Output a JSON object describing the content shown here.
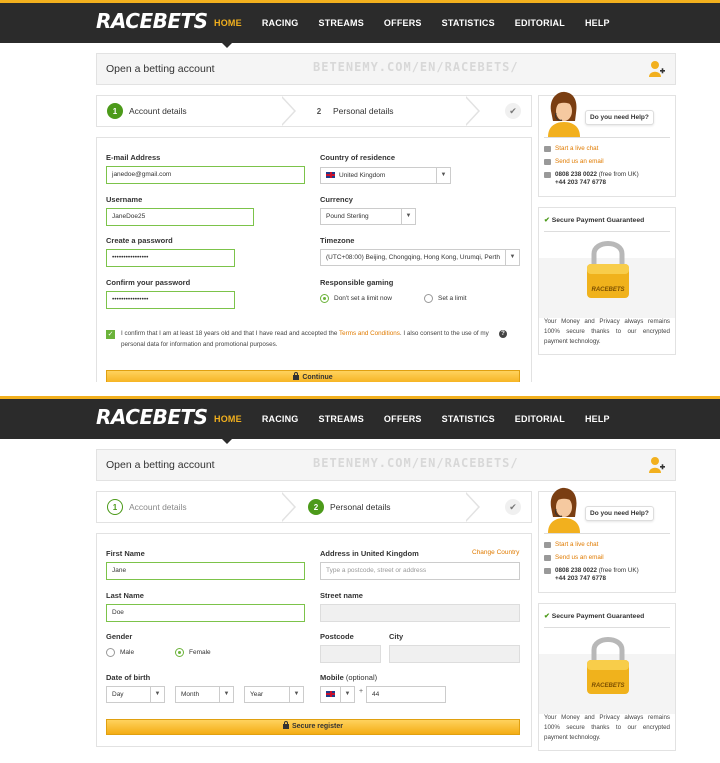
{
  "header": {
    "logo": "RACEBETS",
    "nav": [
      "HOME",
      "RACING",
      "STREAMS",
      "OFFERS",
      "STATISTICS",
      "EDITORIAL",
      "HELP"
    ],
    "active_nav": "HOME"
  },
  "page": {
    "title": "Open a betting account",
    "watermark": "BETENEMY.COM/EN/RACEBETS/"
  },
  "steps": {
    "step1_num": "1",
    "step1_label": "Account details",
    "step2_num": "2",
    "step2_label": "Personal details",
    "done_icon": "✔"
  },
  "form1": {
    "email_label": "E-mail Address",
    "email_value": "janedoe@gmail.com",
    "username_label": "Username",
    "username_value": "JaneDoe25",
    "password_label": "Create a password",
    "password_value": "••••••••••••••••",
    "confirm_label": "Confirm your password",
    "confirm_value": "••••••••••••••••",
    "country_label": "Country of residence",
    "country_value": "United Kingdom",
    "currency_label": "Currency",
    "currency_value": "Pound Sterling",
    "timezone_label": "Timezone",
    "timezone_value": "(UTC+08:00) Beijing, Chongqing, Hong Kong, Urumqi, Perth",
    "gaming_label": "Responsible gaming",
    "gaming_opt1": "Don't set a limit now",
    "gaming_opt2": "Set a limit",
    "consent_pre": "I confirm that I am at least 18 years old and that I have read and accepted the",
    "consent_link": "Terms and Conditions",
    "consent_post": ". I also consent to the use of my personal data for information and promotional purposes.",
    "help_mark": "?",
    "continue_label": "Continue"
  },
  "form2": {
    "first_name_label": "First Name",
    "first_name_value": "Jane",
    "last_name_label": "Last Name",
    "last_name_value": "Doe",
    "gender_label": "Gender",
    "gender_male": "Male",
    "gender_female": "Female",
    "dob_label": "Date of birth",
    "dob_day": "Day",
    "dob_month": "Month",
    "dob_year": "Year",
    "address_label": "Address in United Kingdom",
    "change_country": "Change Country",
    "address_placeholder": "Type a postcode, street or address",
    "street_label": "Street name",
    "postcode_label": "Postcode",
    "city_label": "City",
    "mobile_label": "Mobile",
    "mobile_optional": "(optional)",
    "mobile_plus": "+",
    "mobile_code": "44",
    "register_label": "Secure register"
  },
  "sidebar": {
    "help_bubble": "Do you need Help?",
    "live_chat": "Start a live chat",
    "email_us": "Send us an email",
    "phone1": "0808 238 0022",
    "phone1_note": "(free from UK)",
    "phone2": "+44 203 747 6778",
    "secure_title": "Secure Payment Guaranteed",
    "secure_text": "Your Money and Privacy always remains 100% secure thanks to our encrypted payment technology.",
    "lock_text": "RACEBETS"
  },
  "colors": {
    "accent": "#f2b01e",
    "green": "#4c9a1a",
    "link": "#e07b00",
    "header_bg": "#2b2b2b"
  }
}
